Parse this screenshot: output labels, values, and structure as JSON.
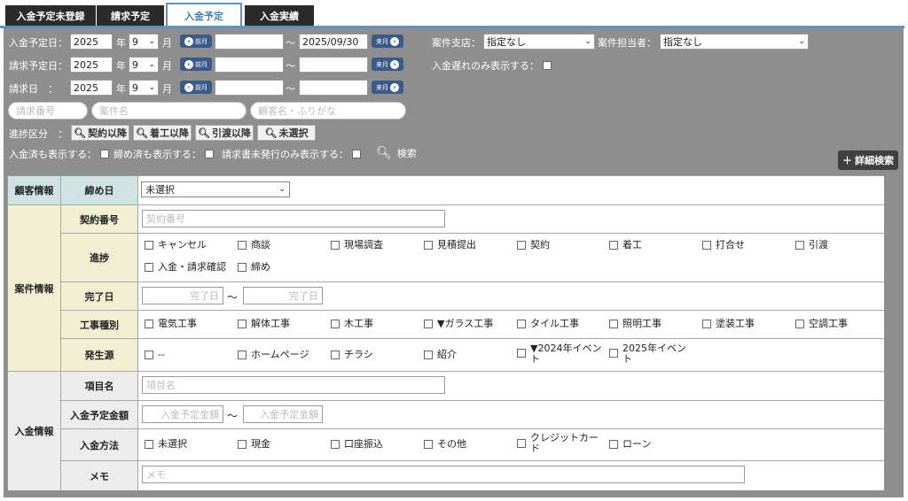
{
  "tabs": [
    {
      "label": "入金予定未登録"
    },
    {
      "label": "請求予定"
    },
    {
      "label": "入金予定"
    },
    {
      "label": "入金実績"
    }
  ],
  "filters": {
    "row1_label": "入金予定日：",
    "row2_label": "請求予定日：",
    "row3_label": "請求日　：",
    "year_value": "2025",
    "year_unit": "年",
    "month_value": "9",
    "month_unit": "月",
    "prev_label": "前月",
    "next_label": "来月",
    "range_sep": "〜",
    "row1_to_value": "2025/09/30",
    "branch_label": "案件支店：",
    "branch_value": "指定なし",
    "staff_label": "案件担当者：",
    "staff_value": "指定なし",
    "late_only_label": "入金遅れのみ表示する：",
    "invoice_no_placeholder": "請求番号",
    "case_name_placeholder": "案件名",
    "customer_placeholder": "顧客名・ふりがな",
    "stage_label": "進捗区分　：",
    "stage_buttons": [
      "契約以降",
      "着工以降",
      "引渡以降",
      "未選択"
    ],
    "paid_label": "入金済も表示する：",
    "closed_label": "締め済も表示する：",
    "unissued_label": "請求書未発行のみ表示する：",
    "search_label": "検索",
    "detail_search_label": "詳細検索"
  },
  "grid": {
    "customer_group": "顧客情報",
    "closing_label": "締め日",
    "closing_value": "未選択",
    "case_group": "案件情報",
    "contract_label": "契約番号",
    "contract_placeholder": "契約番号",
    "progress_label": "進捗",
    "progress_options": [
      "キャンセル",
      "商談",
      "現場調査",
      "見積提出",
      "契約",
      "着工",
      "打合せ",
      "引渡",
      "入金・請求確認",
      "締め"
    ],
    "complete_label": "完了日",
    "complete_placeholder": "完了日",
    "range_sep": "〜",
    "work_label": "工事種別",
    "work_options": [
      "電気工事",
      "解体工事",
      "木工事",
      "▼ガラス工事",
      "タイル工事",
      "照明工事",
      "塗装工事",
      "空調工事"
    ],
    "source_label": "発生源",
    "source_options": [
      "--",
      "ホームページ",
      "チラシ",
      "紹介",
      "▼2024年イベント",
      "2025年イベント"
    ],
    "payment_group": "入金情報",
    "item_label": "項目名",
    "item_placeholder": "項目名",
    "amount_label": "入金予定金額",
    "amount_placeholder": "入金予定金額",
    "method_label": "入金方法",
    "method_options": [
      "未選択",
      "現金",
      "口座振込",
      "その他",
      "クレジットカード",
      "ローン"
    ],
    "memo_label": "メモ",
    "memo_placeholder": "メモ"
  },
  "colors": {
    "tab_dark": "#2b2b2b",
    "tab_active_border": "#5d91c9",
    "panel_gray": "#8e8e8e",
    "nav_button": "#3a5a8a",
    "customer_header": "#cfe3e3",
    "case_header": "#f2eed2",
    "payment_header": "#ececec"
  }
}
